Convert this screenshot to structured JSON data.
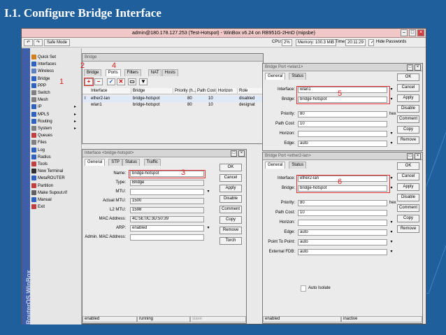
{
  "slide_title": "I.1. Configure Bridge Interface",
  "winbox": {
    "title": "admin@180.178.127.253 (Test-Hotspot) - WinBox v6.24 on RB951G-2HnD (mipsbe)",
    "safe_mode": "Safe Mode",
    "cpu_label": "CPU:",
    "cpu_value": "2%",
    "memory": "Memory: 100.3 MiB",
    "time_label": "Time:",
    "time_value": "20:11:29",
    "hide_passwords": "Hide Passwords",
    "brand": "RouterOS WinBox"
  },
  "sidebar": {
    "items": [
      "Quick Set",
      "Interfaces",
      "Wireless",
      "Bridge",
      "PPP",
      "Switch",
      "Mesh",
      "IP",
      "MPLS",
      "Routing",
      "System",
      "Queues",
      "Files",
      "Log",
      "Radius",
      "Tools",
      "New Terminal",
      "MetaROUTER",
      "Partition",
      "Make Supout.rif",
      "Manual",
      "Exit"
    ]
  },
  "bridge": {
    "title": "Bridge",
    "tabs": [
      "Bridge",
      "Ports",
      "Filters",
      "NAT",
      "Hosts"
    ],
    "columns": [
      "Interface",
      "Bridge",
      "Priority (h...",
      "Path Cost",
      "Horizon",
      "Role"
    ],
    "rows": [
      {
        "flag": "I",
        "interface": "ether2-lan",
        "bridge": "bridge-hotspot",
        "priority": "80",
        "cost": "10",
        "horizon": "",
        "role": "disabled"
      },
      {
        "flag": "",
        "interface": "wlan1",
        "bridge": "bridge-hotspot",
        "priority": "80",
        "cost": "10",
        "horizon": "",
        "role": "designat"
      }
    ],
    "status": [
      "enabled",
      "running",
      "slave"
    ]
  },
  "iface": {
    "title": "Interface <bridge-hotspot>",
    "tabs": [
      "General",
      "STP",
      "Status",
      "Traffic"
    ],
    "labels": [
      "Name:",
      "Type:",
      "MTU:",
      "Actual MTU:",
      "L2 MTU:",
      "MAC Address:",
      "ARP:",
      "Admin. MAC Address:"
    ],
    "values": [
      "bridge-hotspot",
      "Bridge",
      "",
      "1500",
      "1598",
      "4C:5E:0C:3D:50:39",
      "enabled",
      ""
    ],
    "buttons": [
      "OK",
      "Cancel",
      "Apply",
      "Disable",
      "Comment",
      "Copy",
      "Remove",
      "Torch"
    ]
  },
  "port1": {
    "title": "Bridge Port <wlan1>",
    "tabs": [
      "General",
      "Status"
    ],
    "labels": [
      "Interface:",
      "Bridge:",
      "Priority:",
      "Path Cost:",
      "Horizon:",
      "Edge:"
    ],
    "values": [
      "wlan1",
      "bridge-hotspot",
      "80",
      "10",
      "",
      "auto"
    ],
    "hex": "hex",
    "buttons": [
      "OK",
      "Cancel",
      "Apply",
      "Disable",
      "Comment",
      "Copy",
      "Remove"
    ]
  },
  "port2": {
    "title": "Bridge Port <ether2-lan>",
    "tabs": [
      "General",
      "Status"
    ],
    "labels": [
      "Interface:",
      "Bridge:",
      "Priority:",
      "Path Cost:",
      "Horizon:",
      "Edge:",
      "Point To Point:",
      "External FDB:"
    ],
    "values": [
      "ether2-lan",
      "bridge-hotspot",
      "80",
      "10",
      "",
      "auto",
      "auto",
      "auto"
    ],
    "hex": "hex",
    "auto_isolate": "Auto Isolate",
    "buttons": [
      "OK",
      "Cancel",
      "Apply",
      "Disable",
      "Comment",
      "Copy",
      "Remove"
    ],
    "status": [
      "enabled",
      "inactive"
    ]
  },
  "annotations": [
    "1",
    "2",
    "3",
    "4",
    "5",
    "6"
  ]
}
